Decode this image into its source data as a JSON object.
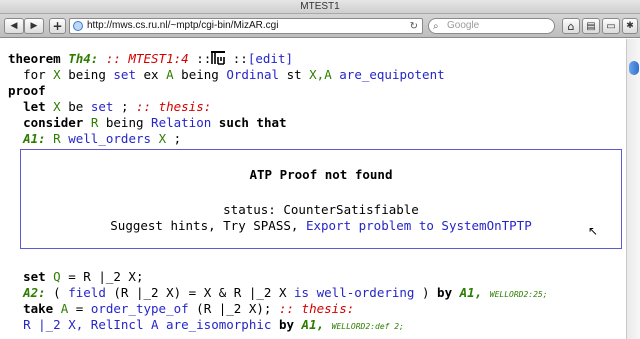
{
  "window": {
    "title": "MTEST1"
  },
  "toolbar": {
    "back_icon": "◀",
    "forward_icon": "▶",
    "add_icon": "+",
    "url": "http://mws.cs.ru.nl/~mptp/cgi-bin/MizAR.cgi",
    "reload_icon": "↻",
    "search_placeholder": "Google",
    "search_icon": "⌕",
    "home_icon": "⌂",
    "bookmark_icon": "▤",
    "page_icon": "▭",
    "settings_icon": "✱"
  },
  "content": {
    "theorem_kw": "theorem",
    "th_label": "Th4:",
    "th_ref": ":: MTEST1:4",
    "colons1": "::",
    "colons2": "::",
    "edit_link": "[edit]",
    "line2": {
      "for": "for",
      "X": "X",
      "being": "being",
      "set": "set",
      "ex": "ex",
      "A": "A",
      "being2": "being",
      "Ordinal": "Ordinal",
      "st": "st",
      "XA": "X,A",
      "are_equipotent": "are_equipotent"
    },
    "proof_kw": "proof",
    "line4": {
      "let": "let",
      "X": "X",
      "be": "be",
      "set": "set",
      "semi": ";",
      "thesis": ":: thesis:"
    },
    "line5": {
      "consider": "consider",
      "R": "R",
      "being": "being",
      "Relation": "Relation",
      "such_that": "such that"
    },
    "line6": {
      "label": "A1:",
      "R": "R",
      "well_orders": "well_orders",
      "X": "X",
      "semi": ";"
    },
    "atp": {
      "title": "ATP Proof not found",
      "status": "status: CounterSatisfiable",
      "suggest": "Suggest hints, Try SPASS,",
      "export_link": "Export problem to SystemOnTPTP"
    },
    "line8": {
      "set": "set",
      "Q": "Q",
      "rest": " = R |_2 X;"
    },
    "line9": {
      "label": "A2:",
      "open": "( ",
      "field": "field",
      "mid1": " (R |_2 X) = X & R |_2 X ",
      "is": "is",
      "well_ordering": "well-ordering",
      "close": " ) ",
      "by": "by",
      "A1": "A1,",
      "ref": "WELLORD2:25;"
    },
    "line10": {
      "take": "take",
      "A": "A",
      "eq": " = ",
      "order_type_of": "order_type_of",
      "mid": " (R |_2 X);",
      "thesis": ":: thesis:"
    },
    "line11": {
      "text": "R |_2 X, RelIncl A are_isomorphic",
      "by": "by",
      "A1": "A1,",
      "ref": "WELLORD2:def 2;"
    }
  }
}
